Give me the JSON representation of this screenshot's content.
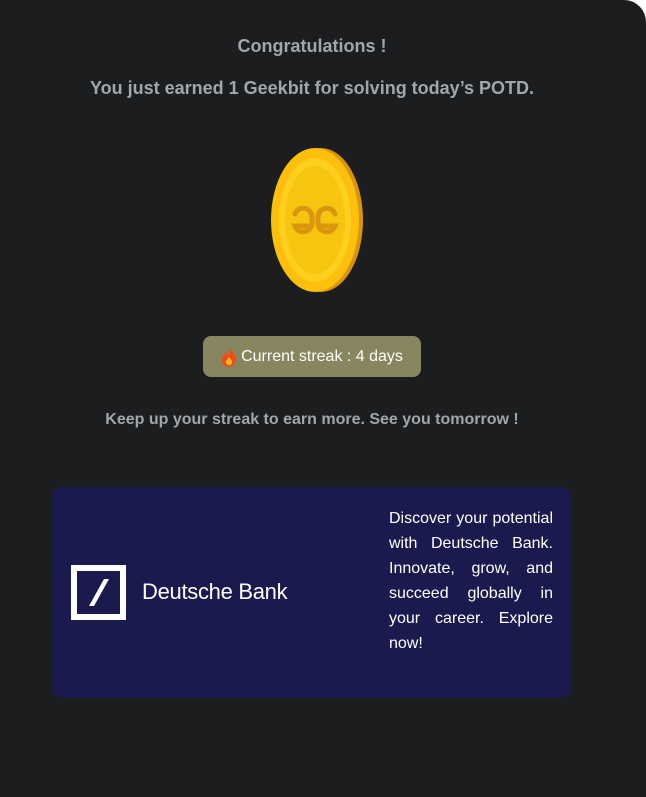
{
  "modal": {
    "title": "Congratulations !",
    "subtitle": "You just earned 1 Geekbit for solving today’s POTD.",
    "coin_icon": "geekbit-coin-icon",
    "streak": {
      "icon": "fire-icon",
      "label": "Current streak : 4 days"
    },
    "footer_message": "Keep up your streak to earn more. See you tomorrow !"
  },
  "ad": {
    "brand_name": "Deutsche Bank",
    "logo_icon": "deutsche-bank-logo-icon",
    "text": "Discover your potential with Deutsche Bank. Innovate, grow, and succeed globally in your career. Explore now!"
  },
  "colors": {
    "modal_background": "#1b1d1f",
    "text_muted": "#a3a6a9",
    "streak_badge": "#88865f",
    "ad_background": "#1a1a4e",
    "coin_gold": "#f6c10e"
  }
}
